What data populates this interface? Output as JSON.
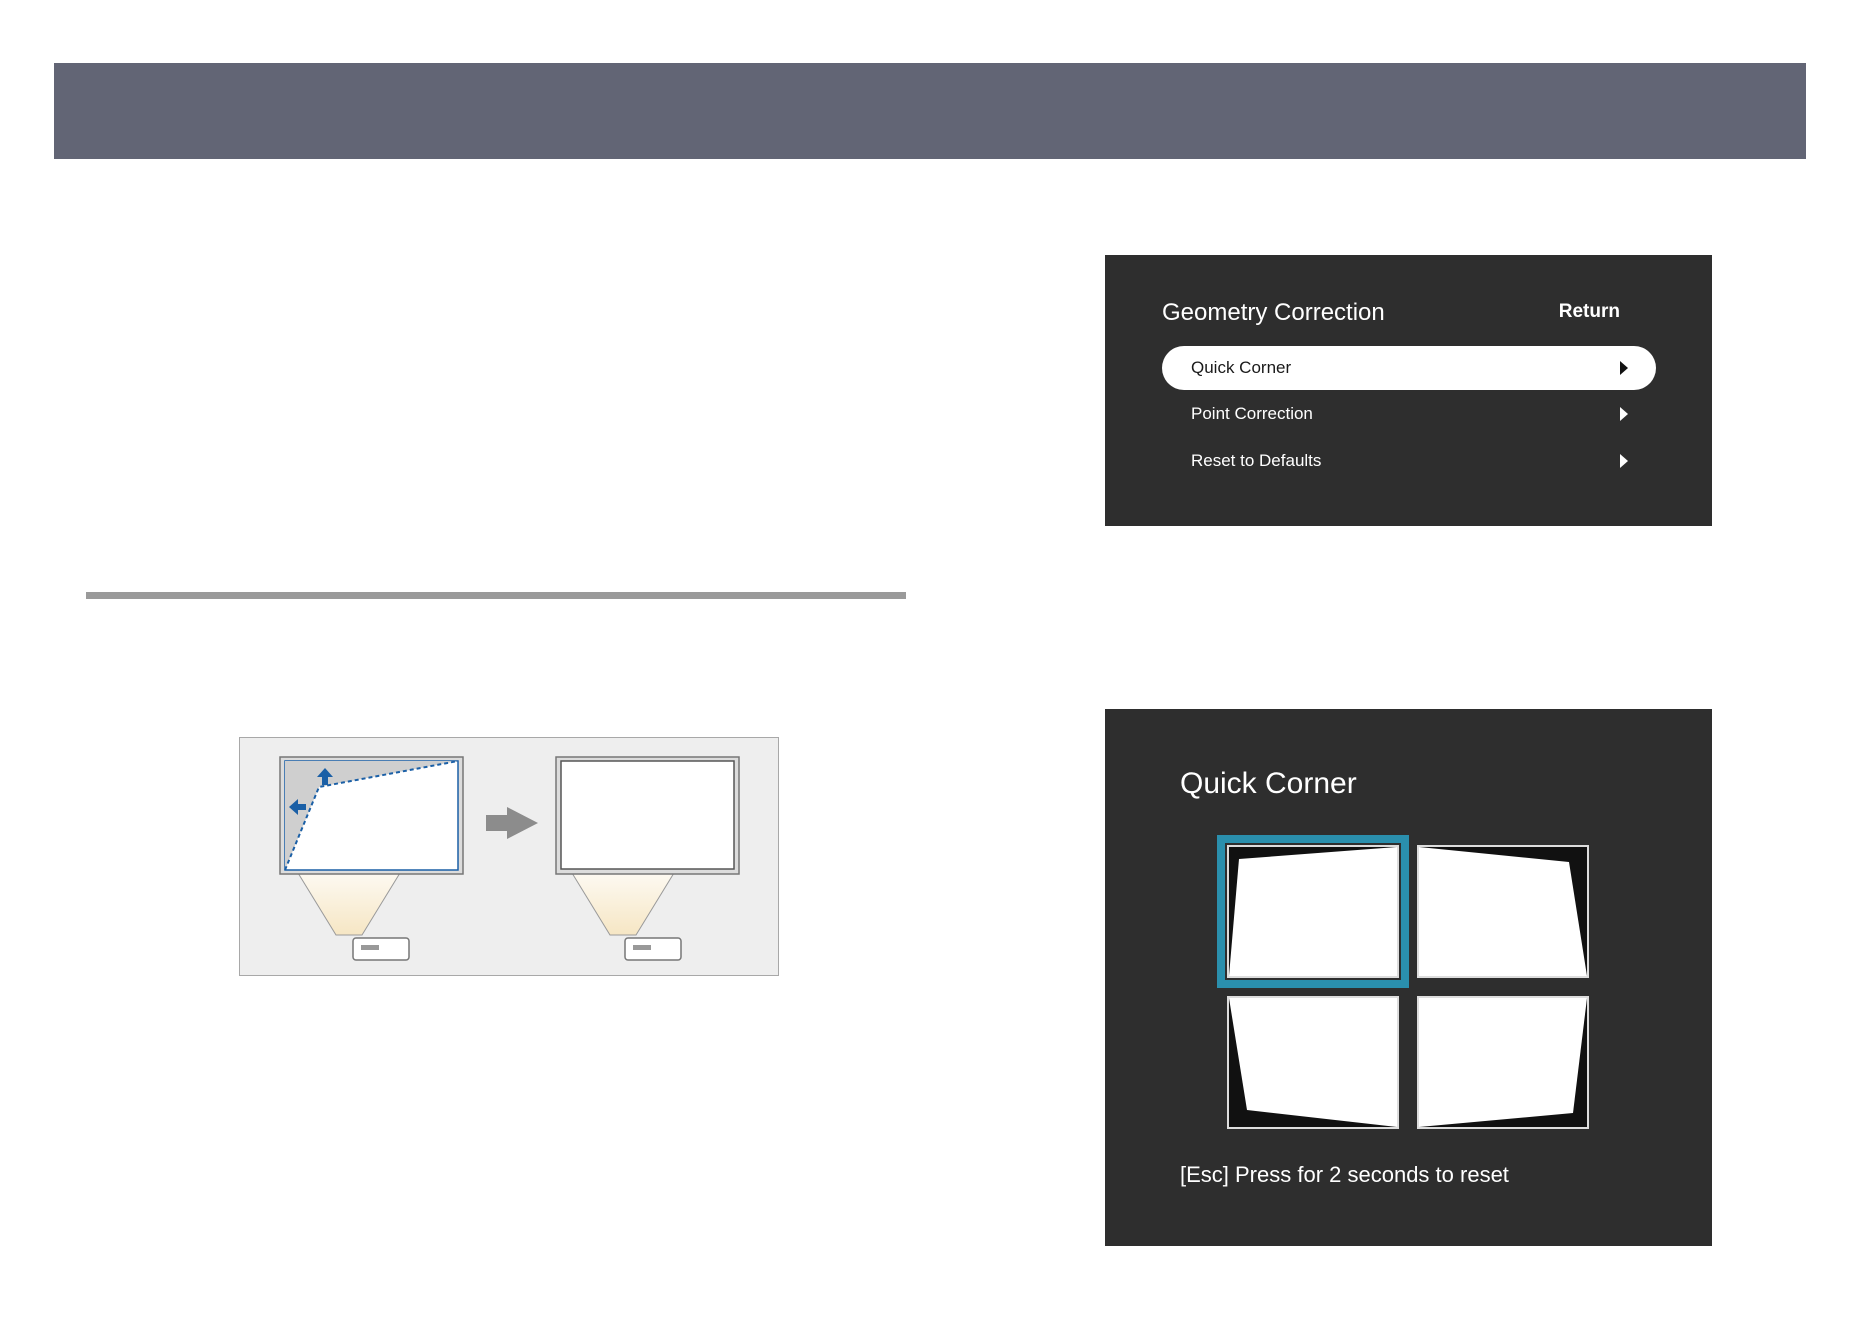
{
  "menu": {
    "title": "Geometry Correction",
    "return_label": "Return",
    "items": [
      {
        "label": "Quick Corner",
        "selected": true
      },
      {
        "label": "Point Correction",
        "selected": false
      },
      {
        "label": "Reset to Defaults",
        "selected": false
      }
    ]
  },
  "quick_corner": {
    "title": "Quick Corner",
    "hint": "[Esc] Press for 2 seconds to reset",
    "selected_tile": "top-left",
    "accent_color": "#2a8fad"
  },
  "colors": {
    "header_band": "#626575",
    "osd_background": "#2e2e2e",
    "illustration_arrow": "#1a5fa6"
  }
}
